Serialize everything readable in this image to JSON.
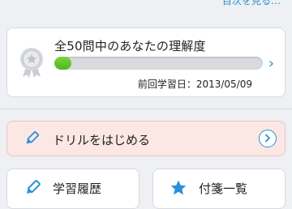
{
  "header": {
    "link_label": "目次を見る…"
  },
  "progress_card": {
    "title": "全50問中のあなたの理解度",
    "progress_fraction": 0.08,
    "last_study": "前回学習日：2013/05/09",
    "chevron": "›"
  },
  "drill_button": {
    "label": "ドリルをはじめる"
  },
  "history_button": {
    "label": "学習履歴"
  },
  "stickies_button": {
    "label": "付箋一覧"
  },
  "colors": {
    "accent": "#2a8fd6",
    "progress_fill": "#5cc22a",
    "drill_bg": "#fbe7e4",
    "background": "#eef0f3"
  },
  "icons": [
    "medal-icon",
    "chevron-right-icon",
    "pencil-icon",
    "circle-arrow-right-icon",
    "star-icon"
  ]
}
